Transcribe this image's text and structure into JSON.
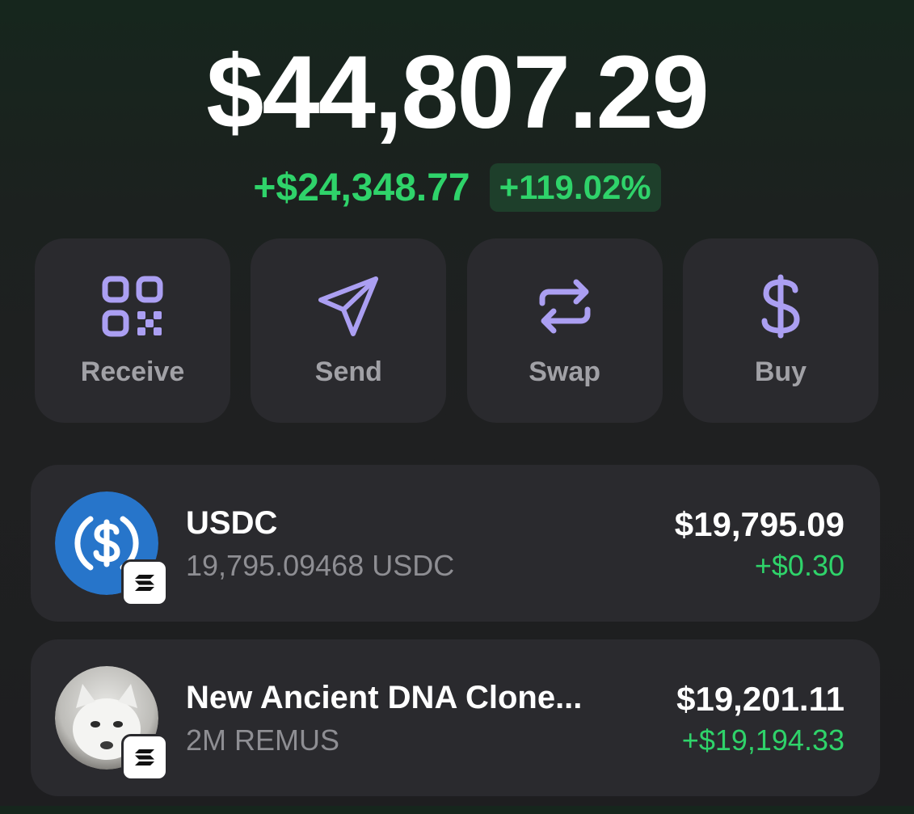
{
  "wallet": {
    "total_balance": "$44,807.29",
    "change_amount": "+$24,348.77",
    "change_percent": "+119.02%"
  },
  "actions": [
    {
      "label": "Receive",
      "icon": "qr-code-icon"
    },
    {
      "label": "Send",
      "icon": "send-icon"
    },
    {
      "label": "Swap",
      "icon": "swap-icon"
    },
    {
      "label": "Buy",
      "icon": "dollar-icon"
    }
  ],
  "tokens": [
    {
      "name": "USDC",
      "amount": "19,795.09468 USDC",
      "value": "$19,795.09",
      "change": "+$0.30",
      "icon": "usdc-logo-icon",
      "chain_icon": "solana-icon"
    },
    {
      "name": "New Ancient DNA Clone...",
      "amount": "2M REMUS",
      "value": "$19,201.11",
      "change": "+$19,194.33",
      "icon": "remus-token-image",
      "chain_icon": "solana-icon"
    }
  ],
  "colors": {
    "positive": "#2fd36a",
    "accent": "#ab9ff2",
    "card": "#2a2a2e",
    "usdc_blue": "#2775ca"
  }
}
